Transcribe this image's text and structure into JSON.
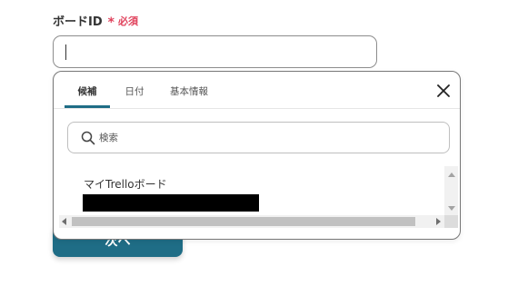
{
  "field": {
    "label": "ボードID",
    "required_mark": "*",
    "required_text": "必須",
    "value": ""
  },
  "next_button": {
    "label": "次へ"
  },
  "dropdown": {
    "tabs": [
      {
        "label": "候補",
        "active": true
      },
      {
        "label": "日付",
        "active": false
      },
      {
        "label": "基本情報",
        "active": false
      }
    ],
    "close_icon": "close-icon",
    "search": {
      "placeholder": "検索",
      "icon": "search-icon"
    },
    "items": [
      {
        "title": "マイTrelloボード",
        "subtitle_redacted": true
      }
    ]
  },
  "colors": {
    "accent": "#1f6d86",
    "required": "#e0425c",
    "redaction": "#000000"
  }
}
